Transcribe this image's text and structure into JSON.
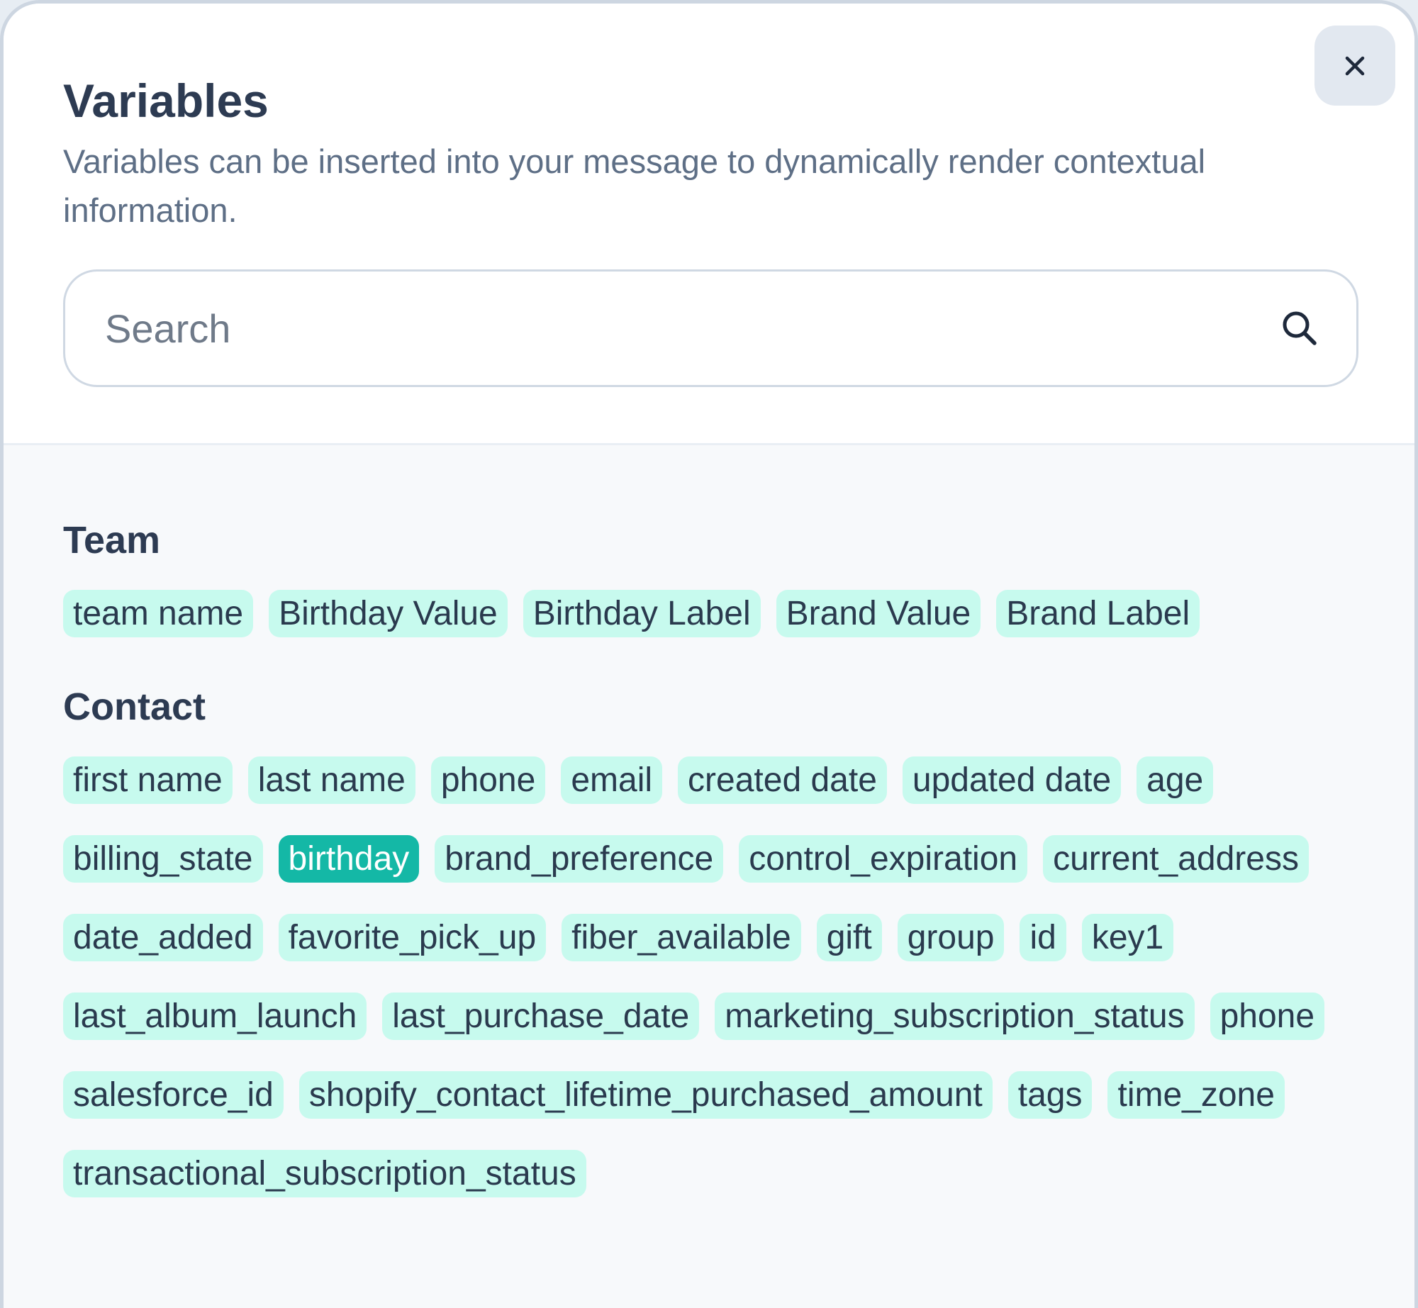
{
  "modal": {
    "title": "Variables",
    "description": "Variables can be inserted into your message to dynamically render contextual information.",
    "close_label": "×",
    "close_icon": "close-icon"
  },
  "search": {
    "placeholder": "Search",
    "value": "",
    "icon": "search-icon"
  },
  "sections": [
    {
      "title": "Team",
      "variables": [
        "team name",
        "Birthday Value",
        "Birthday Label",
        "Brand Value",
        "Brand Label"
      ]
    },
    {
      "title": "Contact",
      "variables": [
        "first name",
        "last name",
        "phone",
        "email",
        "created date",
        "updated date",
        "age",
        "billing_state",
        "birthday",
        "brand_preference",
        "control_expiration",
        "current_address",
        "date_added",
        "favorite_pick_up",
        "fiber_available",
        "gift",
        "group",
        "id",
        "key1",
        "last_album_launch",
        "last_purchase_date",
        "marketing_subscription_status",
        "phone",
        "salesforce_id",
        "shopify_contact_lifetime_purchased_amount",
        "tags",
        "time_zone",
        "transactional_subscription_status"
      ]
    }
  ],
  "selected_variable": "birthday",
  "colors": {
    "chip_background": "#c7faee",
    "chip_selected_background": "#14b8a6",
    "title_text": "#2d3b52",
    "description_text": "#5e6f86"
  }
}
